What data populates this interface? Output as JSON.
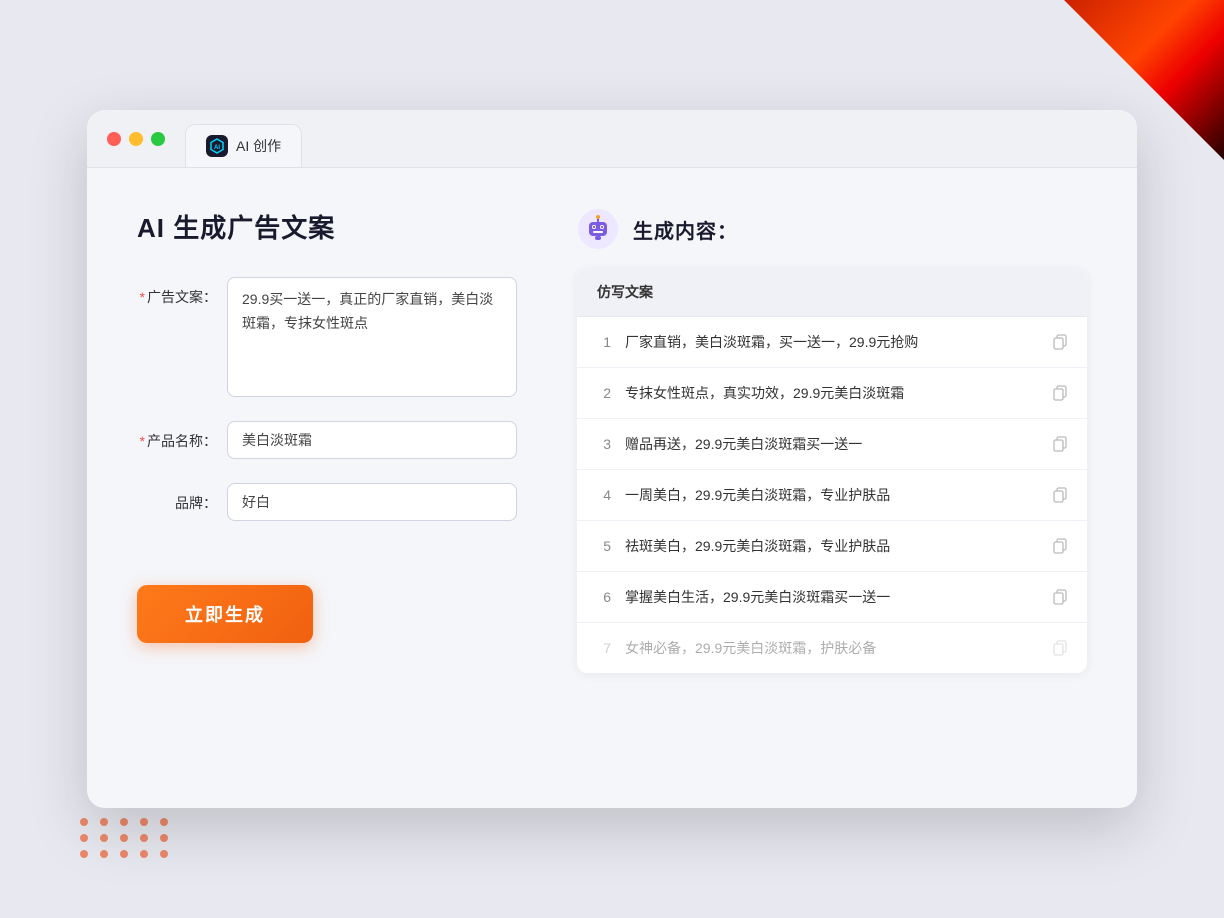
{
  "browser": {
    "tab_label": "AI 创作",
    "tab_icon_text": "AI"
  },
  "left_panel": {
    "title": "AI 生成广告文案",
    "fields": [
      {
        "label": "广告文案：",
        "required": true,
        "type": "textarea",
        "value": "29.9买一送一，真正的厂家直销，美白淡斑霜，专抹女性斑点",
        "placeholder": ""
      },
      {
        "label": "产品名称：",
        "required": true,
        "type": "input",
        "value": "美白淡斑霜",
        "placeholder": ""
      },
      {
        "label": "品牌：",
        "required": false,
        "type": "input",
        "value": "好白",
        "placeholder": ""
      }
    ],
    "generate_button": "立即生成"
  },
  "right_panel": {
    "title": "生成内容：",
    "column_header": "仿写文案",
    "results": [
      {
        "num": "1",
        "text": "厂家直销，美白淡斑霜，买一送一，29.9元抢购",
        "faded": false
      },
      {
        "num": "2",
        "text": "专抹女性斑点，真实功效，29.9元美白淡斑霜",
        "faded": false
      },
      {
        "num": "3",
        "text": "赠品再送，29.9元美白淡斑霜买一送一",
        "faded": false
      },
      {
        "num": "4",
        "text": "一周美白，29.9元美白淡斑霜，专业护肤品",
        "faded": false
      },
      {
        "num": "5",
        "text": "祛斑美白，29.9元美白淡斑霜，专业护肤品",
        "faded": false
      },
      {
        "num": "6",
        "text": "掌握美白生活，29.9元美白淡斑霜买一送一",
        "faded": false
      },
      {
        "num": "7",
        "text": "女神必备，29.9元美白淡斑霜，护肤必备",
        "faded": true
      }
    ]
  }
}
